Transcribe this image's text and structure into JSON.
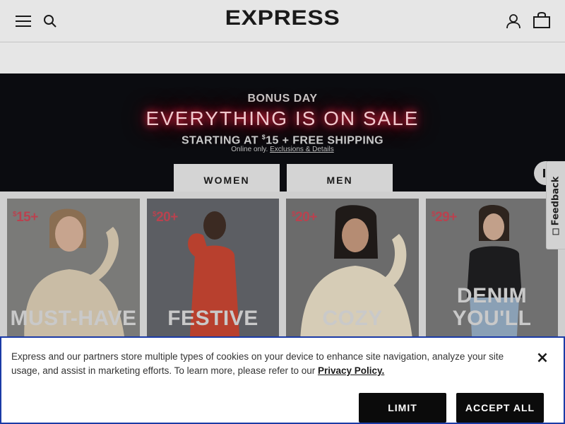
{
  "header": {
    "logo": "EXPRESS",
    "icons": [
      "hamburger-menu-icon",
      "search-icon",
      "account-icon",
      "shopping-bag-icon"
    ]
  },
  "hero": {
    "kicker": "BONUS DAY",
    "title": "EVERYTHING IS ON SALE",
    "subtitle_pre": "STARTING AT ",
    "subtitle_currency": "$",
    "subtitle_post": "15 + FREE SHIPPING",
    "note": "Online only.",
    "note_link": "Exclusions & Details",
    "title_glow_color": "#ff2a4a"
  },
  "tabs": [
    {
      "label": "WOMEN"
    },
    {
      "label": "MEN"
    }
  ],
  "feedback": {
    "label": "Feedback"
  },
  "cards": [
    {
      "price_currency": "$",
      "price": "15+",
      "title_line1": "MUST-HAVE",
      "title_line2": ""
    },
    {
      "price_currency": "$",
      "price": "20+",
      "title_line1": "FESTIVE",
      "title_line2": ""
    },
    {
      "price_currency": "$",
      "price": "20+",
      "title_line1": "COZY",
      "title_line2": ""
    },
    {
      "price_currency": "$",
      "price": "29+",
      "title_line1": "DENIM",
      "title_line2": "YOU'LL"
    }
  ],
  "cookie_banner": {
    "text": "Express and our partners store multiple types of cookies on your device to enhance site navigation, analyze your site usage, and assist in marketing efforts. To learn more, please refer to our",
    "link": "Privacy Policy.",
    "limit_label": "LIMIT",
    "accept_label": "ACCEPT ALL"
  },
  "colors": {
    "price": "#b9424f",
    "banner_border": "#1a3aa6",
    "button": "#0b0b0b"
  }
}
